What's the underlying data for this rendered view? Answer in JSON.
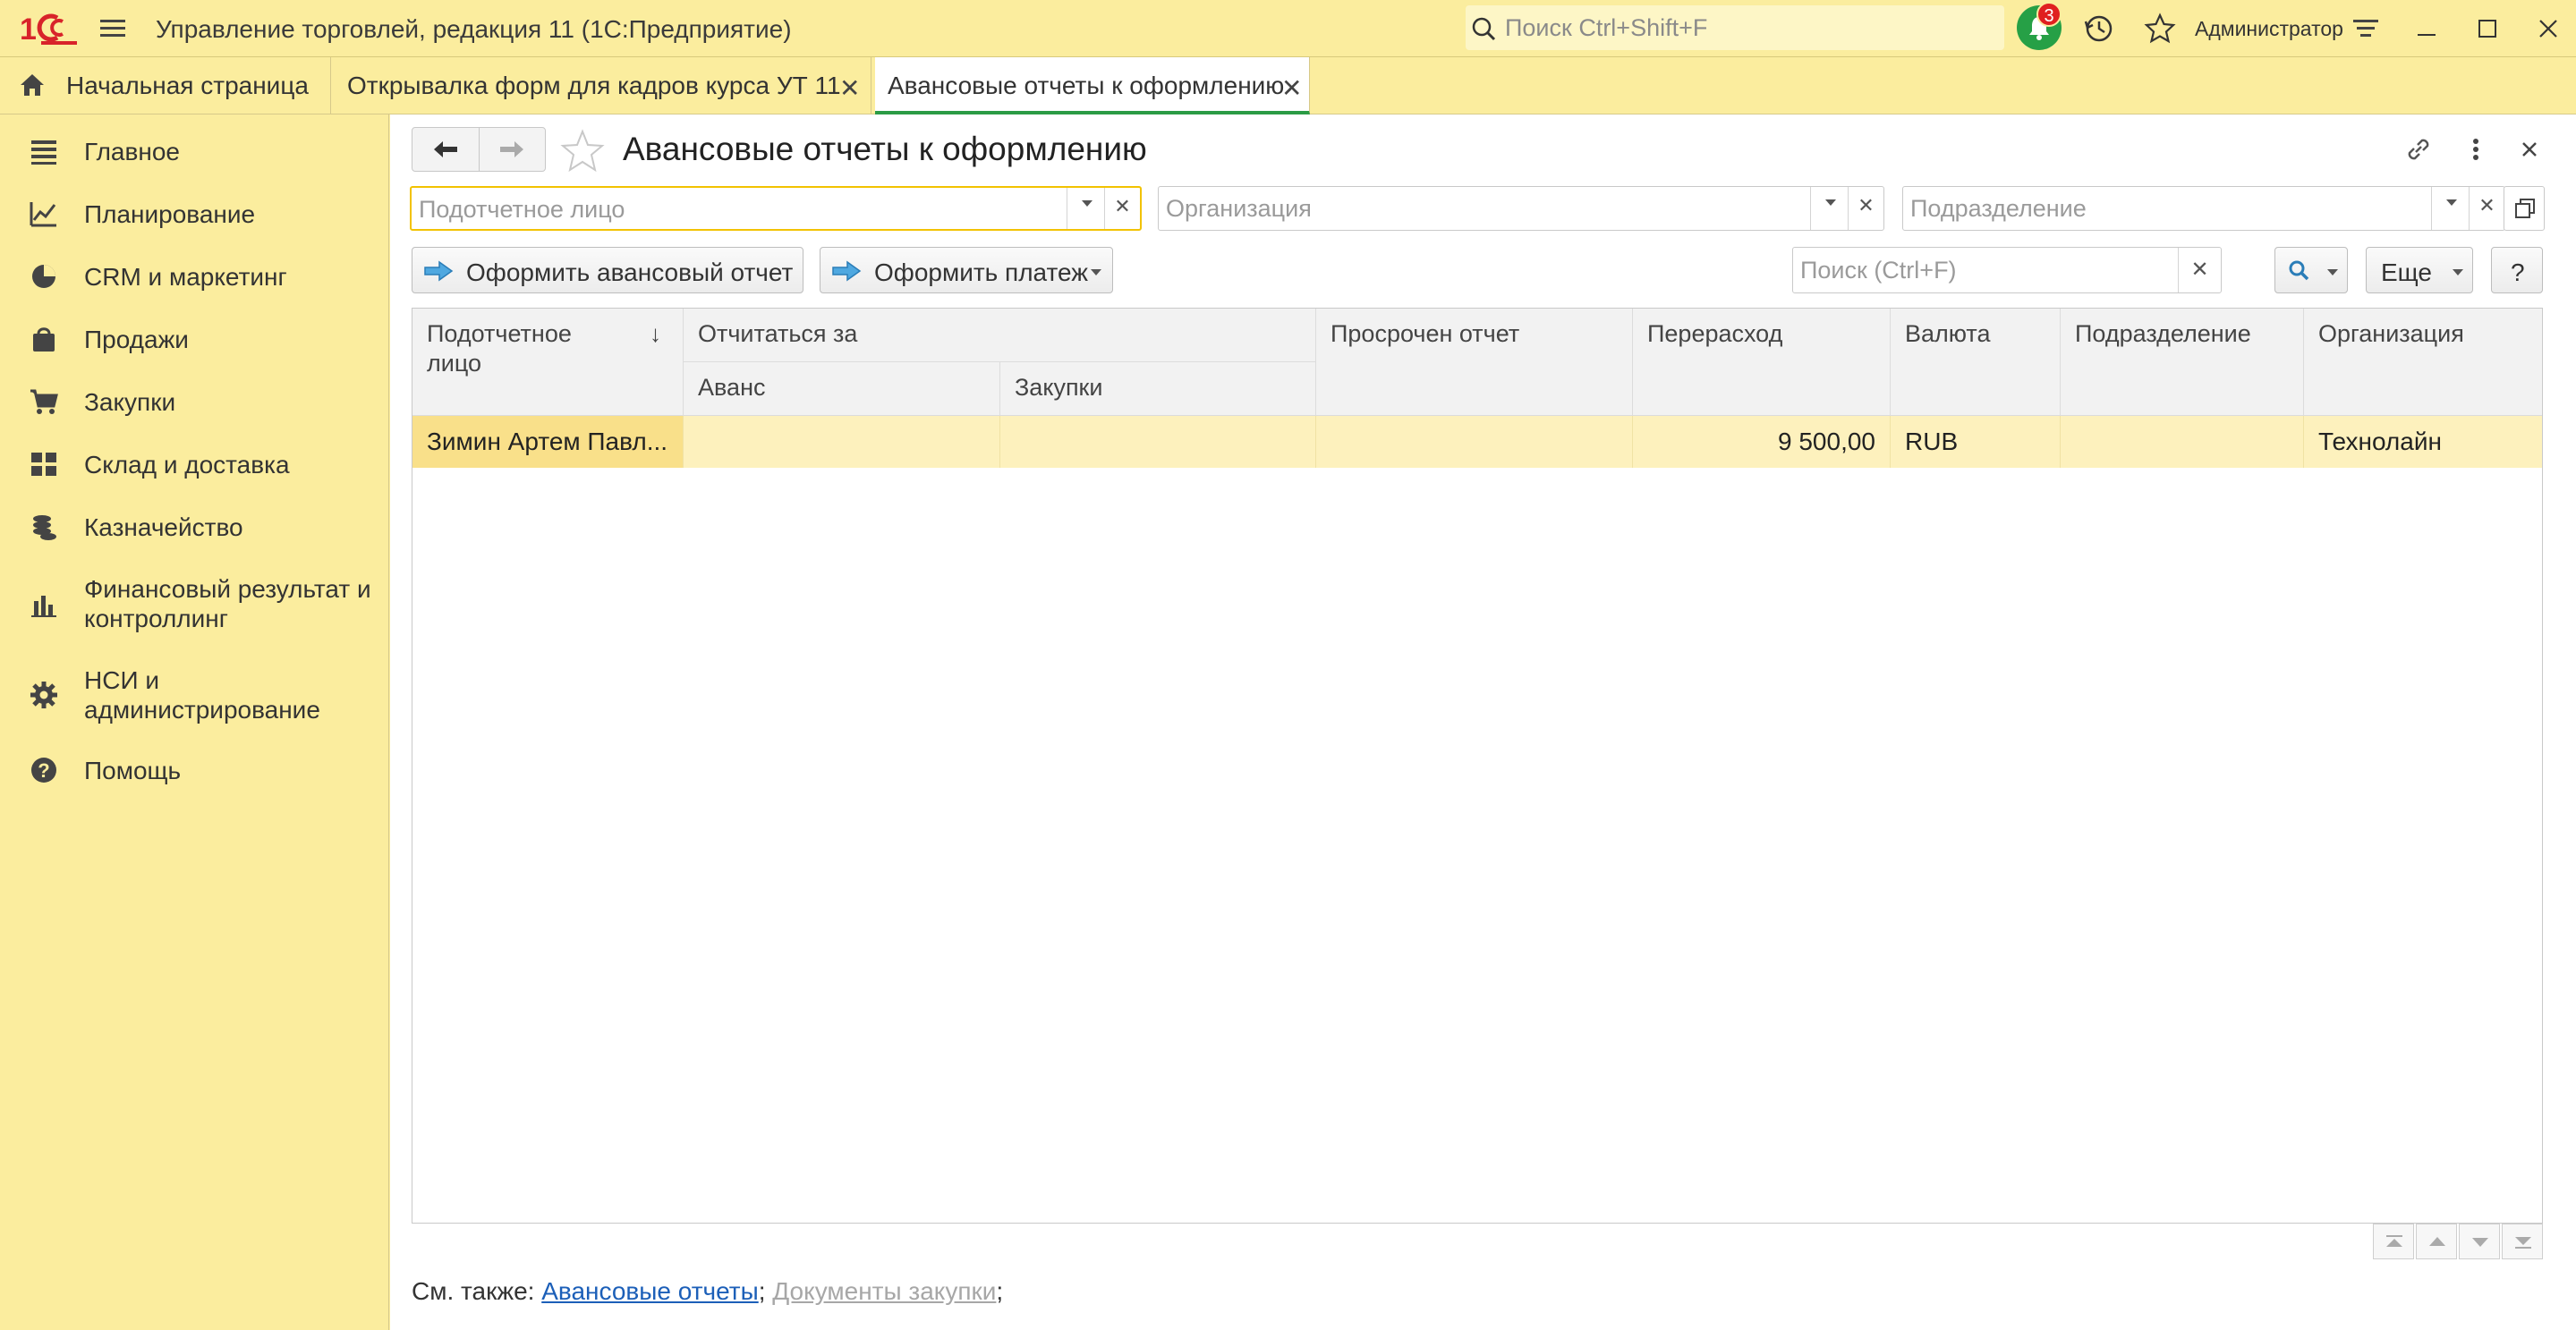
{
  "app": {
    "title": "Управление торговлей, редакция 11  (1С:Предприятие)",
    "search_placeholder": "Поиск Ctrl+Shift+F",
    "notifications_count": "3",
    "user": "Администратор",
    "accent": "#2b9b45",
    "brand_red": "#d8232a"
  },
  "tabs": [
    {
      "label": "Начальная страница",
      "icon": "home-icon"
    },
    {
      "label": "Открывалка форм для кадров курса УТ 11",
      "closable": true
    },
    {
      "label": "Авансовые отчеты к оформлению",
      "closable": true,
      "active": true
    }
  ],
  "sidebar": {
    "items": [
      {
        "label": "Главное",
        "icon": "menu-list-icon"
      },
      {
        "label": "Планирование",
        "icon": "planning-icon"
      },
      {
        "label": "CRM и маркетинг",
        "icon": "crm-pie-icon"
      },
      {
        "label": "Продажи",
        "icon": "shopping-bag-icon"
      },
      {
        "label": "Закупки",
        "icon": "cart-icon"
      },
      {
        "label": "Склад и доставка",
        "icon": "warehouse-icon"
      },
      {
        "label": "Казначейство",
        "icon": "coins-icon"
      },
      {
        "label": "Финансовый результат и контроллинг",
        "icon": "bar-chart-icon"
      },
      {
        "label": "НСИ и администрирование",
        "icon": "gear-icon"
      },
      {
        "label": "Помощь",
        "icon": "help-icon"
      }
    ]
  },
  "form": {
    "title": "Авансовые отчеты к оформлению",
    "filters": {
      "person_placeholder": "Подотчетное лицо",
      "org_placeholder": "Организация",
      "dept_placeholder": "Подразделение"
    },
    "buttons": {
      "create_report": "Оформить авансовый отчет",
      "create_payment": "Оформить платеж",
      "more": "Еще",
      "help": "?"
    },
    "list_search_placeholder": "Поиск (Ctrl+F)",
    "table": {
      "columns": {
        "person": "Подотчетное лицо",
        "report_for": "Отчитаться за",
        "advance": "Аванс",
        "purchases": "Закупки",
        "overdue": "Просрочен отчет",
        "overspend": "Перерасход",
        "currency": "Валюта",
        "department": "Подразделение",
        "organization": "Организация"
      },
      "rows": [
        {
          "person": "Зимин Артем Павл...",
          "advance": "",
          "purchases": "",
          "overdue": "",
          "overspend": "9 500,00",
          "currency": "RUB",
          "department": "",
          "organization": "Технолайн"
        }
      ]
    },
    "see_also": {
      "label": "См. также:",
      "link1": "Авансовые отчеты",
      "sep1": ";",
      "link2": "Документы закупки",
      "sep2": ";"
    }
  }
}
